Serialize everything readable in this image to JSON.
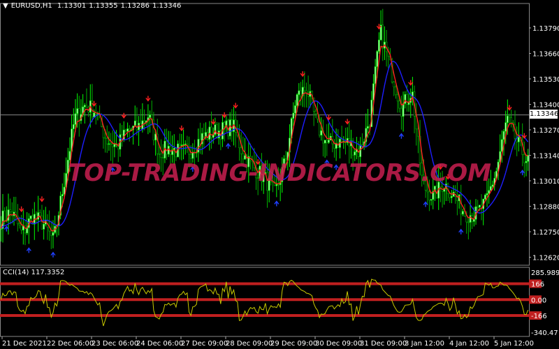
{
  "header": {
    "symbol": "EURUSD,H1",
    "open": "1.13301",
    "high": "1.13355",
    "low": "1.13286",
    "close": "1.13346"
  },
  "watermark": "TOP-TRADING-INDICATORS.COM",
  "colors": {
    "background": "#000000",
    "bull": "#00ff00",
    "bull_body": "#b0ffb0",
    "bear": "#00b000",
    "slow_ma": "#1e1eff",
    "fast_ma": "#ff2020",
    "sell_arrow": "#ff2020",
    "buy_arrow": "#2040ff",
    "cci": "#c8c800",
    "levels": "#c02020"
  },
  "chart_data": [
    {
      "type": "candlestick",
      "symbol": "EURUSD",
      "timeframe": "H1",
      "ylim": [
        1.1254,
        1.1396
      ],
      "price_ticks": [
        "1.13790",
        "1.13660",
        "1.13530",
        "1.13400",
        "1.13270",
        "1.13140",
        "1.13010",
        "1.12880",
        "1.12750",
        "1.12620"
      ],
      "current_price": "1.13346",
      "time_ticks": [
        "21 Dec 2021",
        "22 Dec 06:00",
        "23 Dec 06:00",
        "24 Dec 06:00",
        "27 Dec 09:00",
        "28 Dec 09:00",
        "29 Dec 09:00",
        "30 Dec 09:00",
        "31 Dec 09:00",
        "3 Jan 12:00",
        "4 Jan 12:00",
        "5 Jan 12:00"
      ],
      "bars": 284,
      "approx_close_path": [
        1.12811,
        1.12854,
        1.1274,
        1.12829,
        1.12793,
        1.12704,
        1.13007,
        1.13327,
        1.13398,
        1.13363,
        1.1322,
        1.13185,
        1.13263,
        1.13281,
        1.13345,
        1.13156,
        1.13177,
        1.13156,
        1.13167,
        1.13228,
        1.13256,
        1.1327,
        1.13291,
        1.13142,
        1.13078,
        1.13024,
        1.12942,
        1.13113,
        1.13434,
        1.13487,
        1.13291,
        1.13192,
        1.1321,
        1.13202,
        1.13156,
        1.13327,
        1.13772,
        1.13576,
        1.1338,
        1.1347,
        1.12989,
        1.12928,
        1.12999,
        1.12935,
        1.12846,
        1.12836,
        1.129,
        1.1306,
        1.13327,
        1.13202,
        1.13106
      ],
      "sell_signal_bars": [
        11,
        22,
        50,
        66,
        79,
        97,
        114,
        120,
        126,
        138,
        162,
        176,
        186,
        203,
        220,
        236,
        240,
        273,
        281
      ],
      "buy_signal_bars": [
        3,
        15,
        28,
        60,
        103,
        122,
        148,
        175,
        180,
        215,
        228,
        247,
        280
      ]
    },
    {
      "type": "line",
      "indicator": "CCI(14)",
      "label": "CCI(14) 117.3352",
      "ylim": [
        -340.47,
        285.989
      ],
      "levels": [
        166,
        0.0,
        -166
      ],
      "tick_labels": [
        "285.989",
        "166",
        "0.00",
        "-166",
        "-340.47"
      ]
    }
  ]
}
